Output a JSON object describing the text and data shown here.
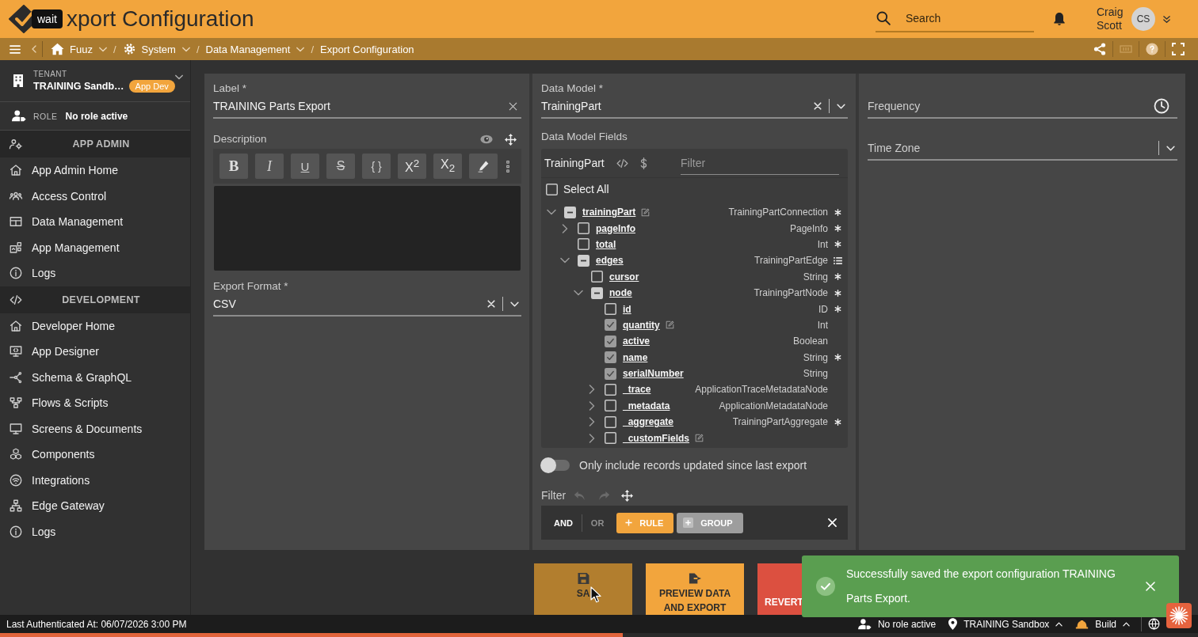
{
  "header": {
    "title": "xport Configuration",
    "tooltip": "wait",
    "search": {
      "placeholder": "Search"
    },
    "user": {
      "name": "Craig Scott",
      "initials": "CS"
    }
  },
  "breadcrumbs": {
    "separator": "/",
    "items": [
      {
        "label": "Fuuz",
        "has_menu": true
      },
      {
        "label": "System",
        "has_menu": true
      },
      {
        "label": "Data Management",
        "has_menu": true
      },
      {
        "label": "Export Configuration",
        "has_menu": false
      }
    ]
  },
  "sidebar": {
    "tenant": {
      "caption": "TENANT",
      "name": "TRAINING Sandb…",
      "badge": "App Dev"
    },
    "role": {
      "caption": "ROLE",
      "value": "No role active"
    },
    "sections": [
      {
        "title": "APP ADMIN",
        "items": [
          {
            "label": "App Admin Home",
            "selected": false
          },
          {
            "label": "Access Control",
            "selected": false
          },
          {
            "label": "Data Management",
            "selected": false
          },
          {
            "label": "App Management",
            "selected": false
          },
          {
            "label": "Logs",
            "selected": false
          }
        ]
      },
      {
        "title": "DEVELOPMENT",
        "items": [
          {
            "label": "Developer Home",
            "selected": false
          },
          {
            "label": "App Designer",
            "selected": false
          },
          {
            "label": "Schema & GraphQL",
            "selected": false
          },
          {
            "label": "Flows & Scripts",
            "selected": false
          },
          {
            "label": "Screens & Documents",
            "selected": false
          },
          {
            "label": "Components",
            "selected": false
          },
          {
            "label": "Integrations",
            "selected": false
          },
          {
            "label": "Edge Gateway",
            "selected": false
          },
          {
            "label": "Logs",
            "selected": false
          }
        ]
      }
    ]
  },
  "form": {
    "label_field": {
      "label": "Label *",
      "value": "TRAINING Parts Export"
    },
    "description": {
      "label": "Description",
      "toolbar": [
        {
          "kind": "bold",
          "label": "B"
        },
        {
          "kind": "italic",
          "label": "I"
        },
        {
          "kind": "underline",
          "label": "U"
        },
        {
          "kind": "strike",
          "label": "S"
        },
        {
          "kind": "code",
          "label": "{ }"
        },
        {
          "kind": "superscript",
          "label": "X$^{2}$"
        },
        {
          "kind": "subscript",
          "label": "X$_{2}$"
        },
        {
          "kind": "highlight"
        }
      ]
    },
    "export_format": {
      "label": "Export Format *",
      "value": "CSV"
    },
    "data_model": {
      "label": "Data Model *",
      "value": "TrainingPart"
    },
    "fields": {
      "label": "Data Model Fields",
      "model": "TrainingPart",
      "filter": {
        "placeholder": "Filter"
      },
      "select_all": {
        "label": "Select All",
        "checked": false
      },
      "tree": [
        {
          "name": "trainingPart",
          "type": "TrainingPartConnection",
          "required": true,
          "list": false,
          "editable": true,
          "checked": false,
          "partial": true,
          "expanded": true,
          "children": [
            {
              "name": "pageInfo",
              "type": "PageInfo",
              "required": true,
              "list": false,
              "editable": false,
              "checked": false,
              "partial": false,
              "expanded": false
            },
            {
              "name": "total",
              "type": "Int",
              "required": true,
              "list": false,
              "editable": false,
              "checked": false,
              "partial": false
            },
            {
              "name": "edges",
              "type": "TrainingPartEdge",
              "required": false,
              "list": true,
              "editable": false,
              "checked": false,
              "partial": true,
              "expanded": true,
              "children": [
                {
                  "name": "cursor",
                  "type": "String",
                  "required": true,
                  "list": false,
                  "editable": false,
                  "checked": false,
                  "partial": false
                },
                {
                  "name": "node",
                  "type": "TrainingPartNode",
                  "required": true,
                  "list": false,
                  "editable": false,
                  "checked": false,
                  "partial": true,
                  "expanded": true,
                  "children": [
                    {
                      "name": "id",
                      "type": "ID",
                      "required": true,
                      "list": false,
                      "editable": false,
                      "checked": false,
                      "partial": false
                    },
                    {
                      "name": "quantity",
                      "type": "Int",
                      "required": false,
                      "list": false,
                      "editable": true,
                      "checked": true,
                      "partial": false
                    },
                    {
                      "name": "active",
                      "type": "Boolean",
                      "required": false,
                      "list": false,
                      "editable": false,
                      "checked": true,
                      "partial": false
                    },
                    {
                      "name": "name",
                      "type": "String",
                      "required": true,
                      "list": false,
                      "editable": false,
                      "checked": true,
                      "partial": false
                    },
                    {
                      "name": "serialNumber",
                      "type": "String",
                      "required": false,
                      "list": false,
                      "editable": false,
                      "checked": true,
                      "partial": false
                    },
                    {
                      "name": "_trace",
                      "type": "ApplicationTraceMetadataNode",
                      "required": false,
                      "list": false,
                      "editable": false,
                      "checked": false,
                      "partial": false,
                      "expanded": false
                    },
                    {
                      "name": "_metadata",
                      "type": "ApplicationMetadataNode",
                      "required": false,
                      "list": false,
                      "editable": false,
                      "checked": false,
                      "partial": false,
                      "expanded": false
                    },
                    {
                      "name": "_aggregate",
                      "type": "TrainingPartAggregate",
                      "required": true,
                      "list": false,
                      "editable": false,
                      "checked": false,
                      "partial": false,
                      "expanded": false
                    },
                    {
                      "name": "_customFields",
                      "required": false,
                      "list": false,
                      "editable": true,
                      "checked": false,
                      "partial": false,
                      "expanded": false
                    }
                  ]
                }
              ]
            }
          ]
        }
      ]
    },
    "incremental": {
      "label": "Only include records updated since last export",
      "on": false
    },
    "filter": {
      "label": "Filter",
      "undo": {
        "disabled": true
      },
      "redo": {
        "disabled": true
      },
      "conjunctions": [
        {
          "label": "AND",
          "selected": true
        },
        {
          "label": "OR",
          "selected": false
        }
      ],
      "add_rule": "RULE",
      "add_group": "GROUP"
    },
    "frequency": {
      "placeholder": "Frequency"
    },
    "time_zone": {
      "placeholder": "Time Zone"
    }
  },
  "actions": [
    {
      "kind": "primary",
      "label": "SA",
      "hovered": true
    },
    {
      "kind": "primary",
      "label": "PREVIEW DATA AND EXPORT",
      "hovered": false
    },
    {
      "kind": "danger",
      "label": "REVERT",
      "hovered": false
    }
  ],
  "toast": {
    "message": "Successfully saved the export configuration TRAINING Parts Export."
  },
  "status_bar": {
    "last_authenticated": "Last Authenticated At: 06/07/2026 3:00 PM",
    "items": [
      {
        "label": "No role active",
        "has_menu": false
      },
      {
        "label": "TRAINING Sandbox",
        "has_menu": true
      },
      {
        "label": "Build",
        "has_menu": true
      }
    ]
  },
  "loading_bar": {
    "level": 0.52
  }
}
